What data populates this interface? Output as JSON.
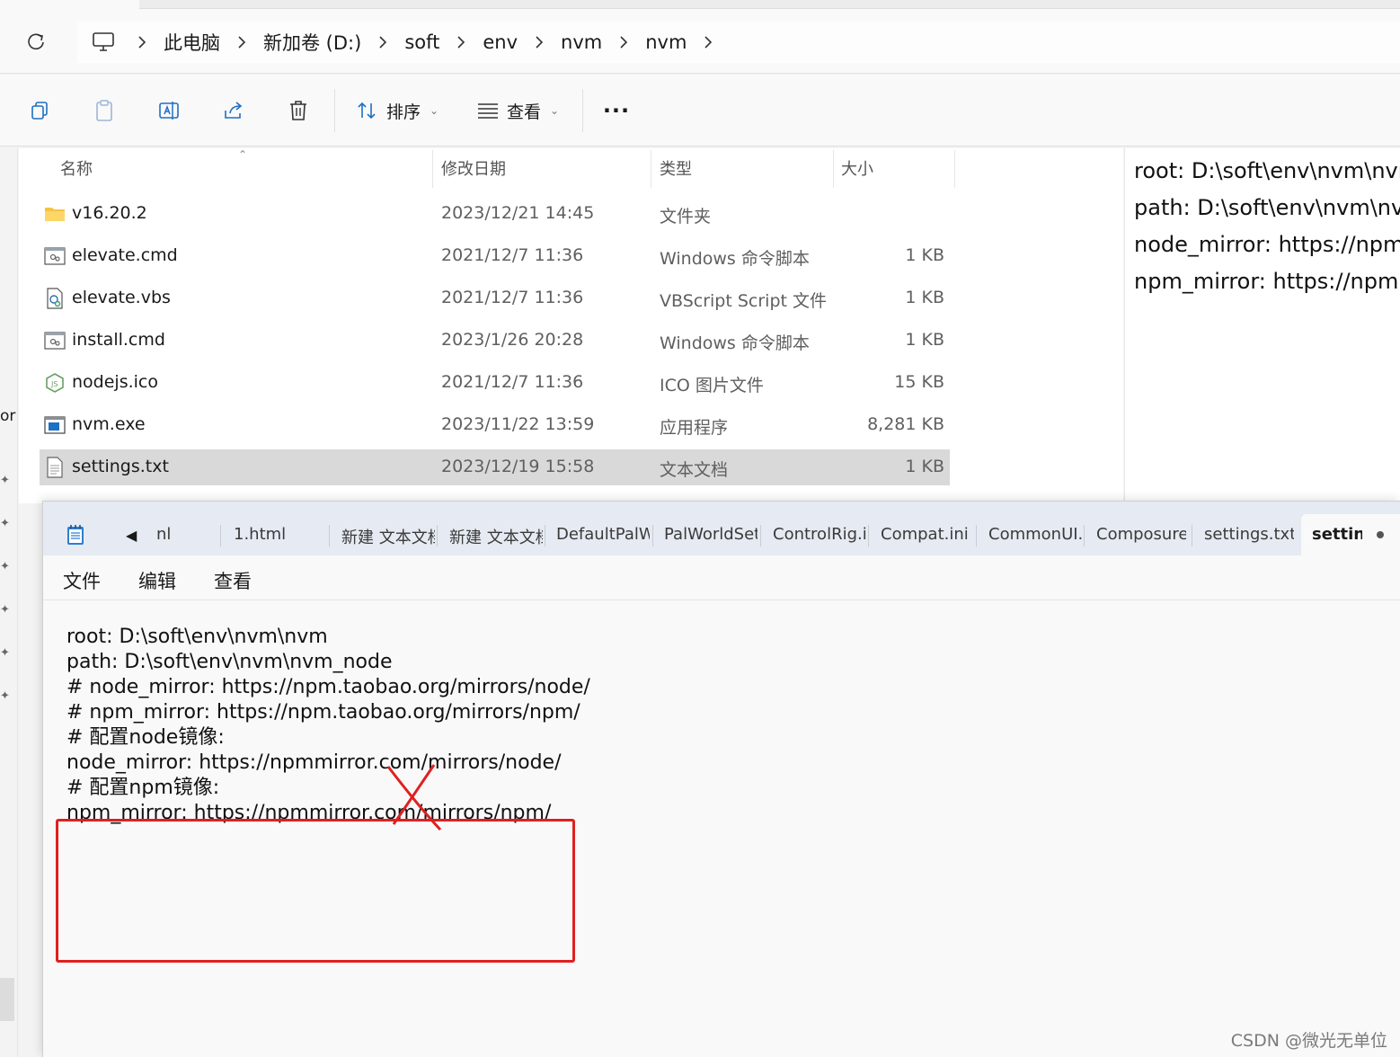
{
  "explorer": {
    "breadcrumb": [
      "此电脑",
      "新加卷 (D:)",
      "soft",
      "env",
      "nvm",
      "nvm"
    ],
    "toolbar": {
      "sort_label": "排序",
      "view_label": "查看"
    },
    "columns": {
      "name": "名称",
      "date": "修改日期",
      "type": "类型",
      "size": "大小"
    },
    "files": [
      {
        "name": "v16.20.2",
        "date": "2023/12/21 14:45",
        "type": "文件夹",
        "size": "",
        "icon": "folder-icon"
      },
      {
        "name": "elevate.cmd",
        "date": "2021/12/7 11:36",
        "type": "Windows 命令脚本",
        "size": "1 KB",
        "icon": "cmd-file-icon"
      },
      {
        "name": "elevate.vbs",
        "date": "2021/12/7 11:36",
        "type": "VBScript Script 文件",
        "size": "1 KB",
        "icon": "vbs-file-icon"
      },
      {
        "name": "install.cmd",
        "date": "2023/1/26 20:28",
        "type": "Windows 命令脚本",
        "size": "1 KB",
        "icon": "cmd-file-icon"
      },
      {
        "name": "nodejs.ico",
        "date": "2021/12/7 11:36",
        "type": "ICO 图片文件",
        "size": "15 KB",
        "icon": "nodejs-icon"
      },
      {
        "name": "nvm.exe",
        "date": "2023/11/22 13:59",
        "type": "应用程序",
        "size": "8,281 KB",
        "icon": "exe-file-icon"
      },
      {
        "name": "settings.txt",
        "date": "2023/12/19 15:58",
        "type": "文本文档",
        "size": "1 KB",
        "icon": "txt-file-icon"
      }
    ],
    "preview_lines": [
      "root: D:\\soft\\env\\nvm\\nvm",
      "path: D:\\soft\\env\\nvm\\nvm",
      "node_mirror: https://npm.taobao.org",
      "npm_mirror: https://npm.taobao.org"
    ],
    "nav_fragment": "or"
  },
  "notepad": {
    "tabs": [
      "nl",
      "1.html",
      "新建 文本文档",
      "新建 文本文档",
      "DefaultPalWorld",
      "PalWorldSettings",
      "ControlRig.ini",
      "Compat.ini",
      "CommonUI.ini",
      "Composure.ini",
      "settings.txt"
    ],
    "active_tab": "settings.txt",
    "menu": [
      "文件",
      "编辑",
      "查看"
    ],
    "lines": [
      "root: D:\\soft\\env\\nvm\\nvm",
      "path: D:\\soft\\env\\nvm\\nvm_node",
      "# node_mirror: https://npm.taobao.org/mirrors/node/",
      "# npm_mirror: https://npm.taobao.org/mirrors/npm/",
      "# 配置node镜像:",
      "node_mirror: https://npmmirror.com/mirrors/node/",
      "# 配置npm镜像:",
      "npm_mirror: https://npmmirror.com/mirrors/npm/"
    ]
  },
  "watermark": "CSDN @微光无单位",
  "colors": {
    "highlight": "#e02020",
    "selected_row": "#d9d9d9",
    "tabbar": "#e6eaf2"
  }
}
